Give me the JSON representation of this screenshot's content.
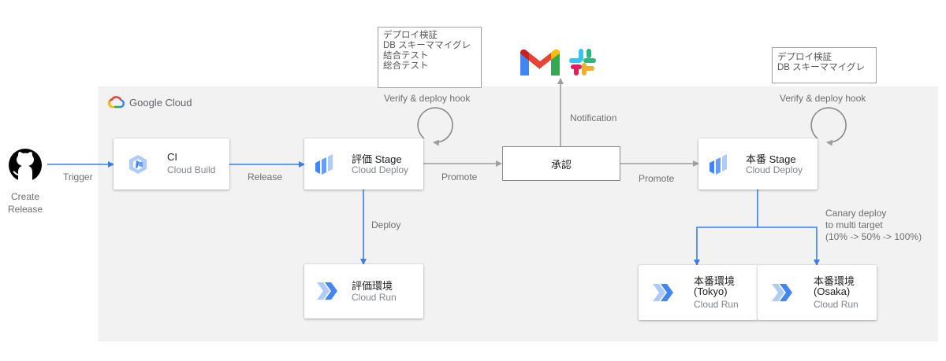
{
  "google_cloud": {
    "label": "Google Cloud"
  },
  "trigger": {
    "create_label": "Create\nRelease",
    "trigger_label": "Trigger"
  },
  "ci": {
    "title": "CI",
    "subtitle": "Cloud Build"
  },
  "release_label": "Release",
  "eval_stage": {
    "title": "評価 Stage",
    "subtitle": "Cloud Deploy"
  },
  "eval_env": {
    "title": "評価環境",
    "subtitle": "Cloud Run"
  },
  "deploy_label": "Deploy",
  "promote_label_1": "Promote",
  "promote_label_2": "Promote",
  "approval": {
    "label": "承認"
  },
  "notification_label": "Notification",
  "verify_hook_left": "Verify & deploy hook",
  "verify_hook_right": "Verify & deploy hook",
  "note_left": [
    "デプロイ検証",
    "DB スキーママイグレ",
    "結合テスト",
    "総合テスト"
  ],
  "note_right": [
    "デプロイ検証",
    "DB スキーママイグレ"
  ],
  "prod_stage": {
    "title": "本番 Stage",
    "subtitle": "Cloud Deploy"
  },
  "canary": [
    "Canary deploy",
    "to multi target",
    "(10% -> 50% -> 100%)"
  ],
  "prod_tokyo": {
    "title_line1": "本番環境",
    "title_line2": "(Tokyo)",
    "subtitle": "Cloud Run"
  },
  "prod_osaka": {
    "title_line1": "本番環境",
    "title_line2": "(Osaka)",
    "subtitle": "Cloud Run"
  },
  "colors": {
    "blue": "#3b7ded",
    "gray_arrow": "#9e9e9e",
    "panel": "#f2f2f2"
  },
  "icons": [
    "github-icon",
    "google-cloud-icon",
    "cloud-build-icon",
    "cloud-deploy-icon",
    "cloud-run-icon",
    "gmail-icon",
    "slack-icon"
  ]
}
